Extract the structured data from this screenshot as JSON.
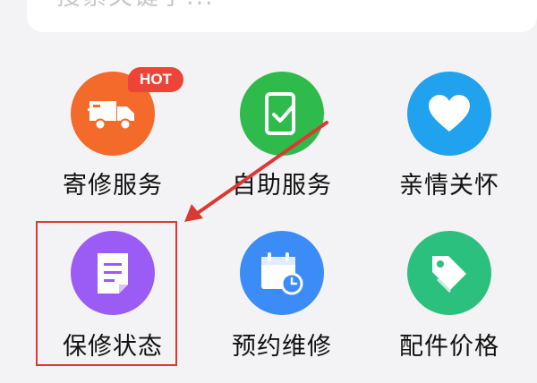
{
  "search": {
    "placeholder": "搜索关键字..."
  },
  "badge": {
    "hot": "HOT"
  },
  "grid": {
    "items": [
      {
        "label": "寄修服务",
        "icon": "truck-icon",
        "color": "#f36a2b"
      },
      {
        "label": "自助服务",
        "icon": "phone-check-icon",
        "color": "#2fbb4b"
      },
      {
        "label": "亲情关怀",
        "icon": "heart-icon",
        "color": "#20a2ee"
      },
      {
        "label": "保修状态",
        "icon": "document-icon",
        "color": "#9a5cf4"
      },
      {
        "label": "预约维修",
        "icon": "calendar-clock-icon",
        "color": "#3b8cf6"
      },
      {
        "label": "配件价格",
        "icon": "tag-icon",
        "color": "#2cc07f"
      }
    ]
  },
  "annotation": {
    "color": "#d93a33"
  }
}
